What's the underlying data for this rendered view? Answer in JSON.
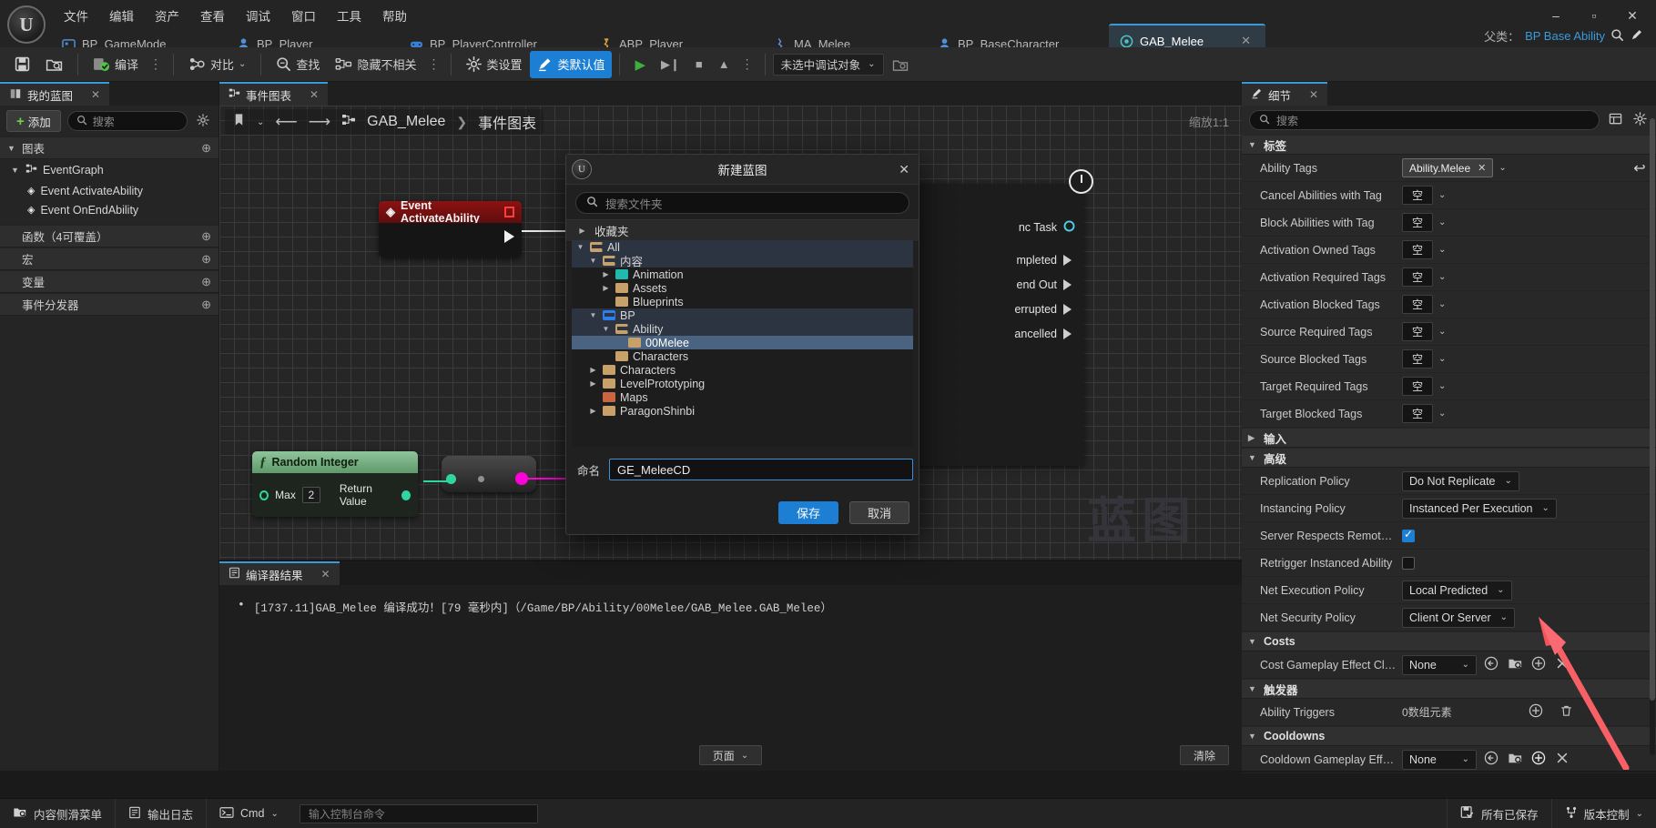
{
  "window": {
    "minimize": "–",
    "maximize": "▫",
    "close": "✕"
  },
  "menubar": {
    "items": [
      "文件",
      "编辑",
      "资产",
      "查看",
      "调试",
      "窗口",
      "工具",
      "帮助"
    ]
  },
  "asset_tabs": [
    {
      "label": "BP_GameMode",
      "icon": "gamemode-icon",
      "active": false
    },
    {
      "label": "BP_Player",
      "icon": "pawn-icon",
      "active": false
    },
    {
      "label": "BP_PlayerController",
      "icon": "controller-icon",
      "active": false
    },
    {
      "label": "ABP_Player",
      "icon": "animbp-icon",
      "active": false
    },
    {
      "label": "MA_Melee",
      "icon": "montage-icon",
      "active": false
    },
    {
      "label": "BP_BaseCharacter",
      "icon": "character-icon",
      "active": false
    },
    {
      "label": "GAB_Melee",
      "icon": "ability-icon",
      "active": true
    }
  ],
  "parent_class": {
    "label": "父类：",
    "value": "BP Base Ability",
    "search_icon": "search-icon",
    "edit_icon": "edit-icon"
  },
  "toolbar": {
    "save_label": "",
    "compile_label": "编译",
    "diff_label": "对比",
    "find_label": "查找",
    "hide_unrelated_label": "隐藏不相关",
    "class_settings_label": "类设置",
    "class_defaults_label": "类默认值",
    "debug_target": "未选中调试对象",
    "dots": "⋮"
  },
  "my_blueprint": {
    "tab_label": "我的蓝图",
    "tab_close": "✕",
    "add_label": "添加",
    "search_placeholder": "搜索",
    "sections": [
      {
        "label": "图表",
        "expanded": true
      },
      {
        "label": "函数（4可覆盖）",
        "expanded": false
      },
      {
        "label": "宏",
        "expanded": false
      },
      {
        "label": "变量",
        "expanded": false
      },
      {
        "label": "事件分发器",
        "expanded": false
      }
    ],
    "graph_root": "EventGraph",
    "graph_items": [
      "Event ActivateAbility",
      "Event OnEndAbility"
    ]
  },
  "graph": {
    "tab_label": "事件图表",
    "tab_close": "✕",
    "breadcrumb_asset": "GAB_Melee",
    "breadcrumb_graph": "事件图表",
    "breadcrumb_sep": "❯",
    "back_arrow": "⟵",
    "forward_arrow": "⟶",
    "zoom_label": "缩放1:1",
    "watermark": "蓝图",
    "nodes": {
      "event_activate": {
        "title": "Event ActivateAbility"
      },
      "random_integer": {
        "title": "Random Integer",
        "fn_glyph": "ƒ",
        "input_pin": "Max",
        "input_value": "2",
        "output_pin": "Return Value"
      },
      "task_node": {
        "rows": [
          "nc Task",
          "mpleted",
          "end Out",
          "errupted",
          "ancelled"
        ]
      }
    }
  },
  "compiler": {
    "tab_label": "编译器结果",
    "tab_close": "✕",
    "message": "[1737.11]GAB_Melee 编译成功！[79 毫秒内]（/Game/BP/Ability/00Melee/GAB_Melee.GAB_Melee）",
    "bullet": "•",
    "page_label": "页面",
    "clear_label": "清除"
  },
  "details": {
    "tab_label": "细节",
    "tab_close": "✕",
    "search_placeholder": "搜索",
    "grid_icon": "grid-view-icon",
    "settings_icon": "gear-icon",
    "categories": [
      {
        "label": "标签",
        "expanded": true,
        "rows": [
          {
            "label": "Ability Tags",
            "type": "tagpill",
            "value": "Ability.Melee",
            "revert": true
          },
          {
            "label": "Cancel Abilities with Tag",
            "type": "tagbox",
            "value": "空"
          },
          {
            "label": "Block Abilities with Tag",
            "type": "tagbox",
            "value": "空"
          },
          {
            "label": "Activation Owned Tags",
            "type": "tagbox",
            "value": "空"
          },
          {
            "label": "Activation Required Tags",
            "type": "tagbox",
            "value": "空"
          },
          {
            "label": "Activation Blocked Tags",
            "type": "tagbox",
            "value": "空"
          },
          {
            "label": "Source Required Tags",
            "type": "tagbox",
            "value": "空"
          },
          {
            "label": "Source Blocked Tags",
            "type": "tagbox",
            "value": "空"
          },
          {
            "label": "Target Required Tags",
            "type": "tagbox",
            "value": "空"
          },
          {
            "label": "Target Blocked Tags",
            "type": "tagbox",
            "value": "空"
          }
        ]
      },
      {
        "label": "输入",
        "expanded": false,
        "rows": []
      },
      {
        "label": "高级",
        "expanded": true,
        "rows": [
          {
            "label": "Replication Policy",
            "type": "combo",
            "value": "Do Not Replicate"
          },
          {
            "label": "Instancing Policy",
            "type": "combo",
            "value": "Instanced Per Execution"
          },
          {
            "label": "Server Respects Remote Ab...",
            "type": "checkbox",
            "checked": true
          },
          {
            "label": "Retrigger Instanced Ability",
            "type": "checkbox",
            "checked": false
          },
          {
            "label": "Net Execution Policy",
            "type": "combo",
            "value": "Local Predicted"
          },
          {
            "label": "Net Security Policy",
            "type": "combo",
            "value": "Client Or Server"
          }
        ]
      },
      {
        "label": "Costs",
        "expanded": true,
        "rows": [
          {
            "label": "Cost Gameplay Effect Class",
            "type": "assetcombo",
            "value": "None"
          }
        ]
      },
      {
        "label": "触发器",
        "expanded": true,
        "rows": [
          {
            "label": "Ability Triggers",
            "type": "array",
            "value": "0数组元素"
          }
        ]
      },
      {
        "label": "Cooldowns",
        "expanded": true,
        "rows": [
          {
            "label": "Cooldown Gameplay Effect...",
            "type": "assetcombo",
            "value": "None"
          }
        ]
      }
    ],
    "asset_icons": {
      "browse_back": "browse-to-asset-icon",
      "find_in_cb": "find-in-content-browser-icon",
      "create_new": "create-new-asset-icon",
      "clear": "clear-asset-icon"
    },
    "array_icons": {
      "add": "add-element-icon",
      "delete": "delete-all-icon"
    }
  },
  "dialog": {
    "title": "新建蓝图",
    "ue_glyph": "U",
    "close": "✕",
    "search_placeholder": "搜索文件夹",
    "favorites_label": "收藏夹",
    "name_label": "命名",
    "name_value": "GE_MeleeCD",
    "save_label": "保存",
    "cancel_label": "取消",
    "tree": [
      {
        "label": "All",
        "depth": 0,
        "caret": "down",
        "color": "tan",
        "open": true,
        "state": "hl"
      },
      {
        "label": "内容",
        "depth": 1,
        "caret": "down",
        "color": "tan",
        "open": true,
        "state": "hl"
      },
      {
        "label": "Animation",
        "depth": 2,
        "caret": "right",
        "color": "teal",
        "open": false,
        "state": ""
      },
      {
        "label": "Assets",
        "depth": 2,
        "caret": "right",
        "color": "tan",
        "open": false,
        "state": ""
      },
      {
        "label": "Blueprints",
        "depth": 2,
        "caret": "",
        "color": "tan",
        "open": false,
        "state": ""
      },
      {
        "label": "BP",
        "depth": 1,
        "caret": "down",
        "color": "blue",
        "open": true,
        "state": "hl"
      },
      {
        "label": "Ability",
        "depth": 2,
        "caret": "down",
        "color": "tan",
        "open": true,
        "state": "hl"
      },
      {
        "label": "00Melee",
        "depth": 3,
        "caret": "",
        "color": "tan",
        "open": false,
        "state": "sel"
      },
      {
        "label": "Characters",
        "depth": 2,
        "caret": "",
        "color": "tan",
        "open": false,
        "state": ""
      },
      {
        "label": "Characters",
        "depth": 1,
        "caret": "right",
        "color": "tan",
        "open": false,
        "state": ""
      },
      {
        "label": "LevelPrototyping",
        "depth": 1,
        "caret": "right",
        "color": "tan",
        "open": false,
        "state": ""
      },
      {
        "label": "Maps",
        "depth": 1,
        "caret": "",
        "color": "red",
        "open": false,
        "state": ""
      },
      {
        "label": "ParagonShinbi",
        "depth": 1,
        "caret": "right",
        "color": "tan",
        "open": false,
        "state": ""
      }
    ]
  },
  "statusbar": {
    "content_drawer": "内容侧滑菜单",
    "output_log": "输出日志",
    "cmd_label": "Cmd",
    "cmd_placeholder": "输入控制台命令",
    "all_saved": "所有已保存",
    "source_control": "版本控制"
  },
  "colors": {
    "accent_blue": "#1d7fd4",
    "tab_active": "#3a9ad9",
    "annotation_red": "#f4545c",
    "exec_green": "#3fae3f",
    "pin_green": "#2fd6a2"
  }
}
